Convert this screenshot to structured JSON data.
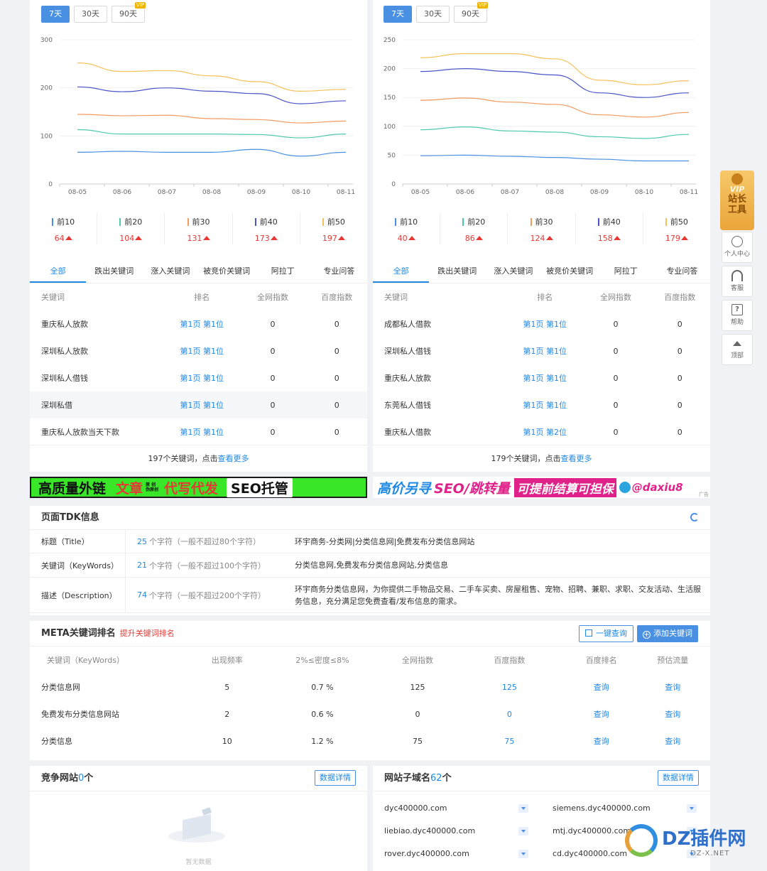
{
  "range_buttons": [
    "7天",
    "30天",
    "90天"
  ],
  "vip_tag": "VIP",
  "left": {
    "chart_data": {
      "type": "line",
      "categories": [
        "08-05",
        "08-06",
        "08-07",
        "08-08",
        "08-09",
        "08-10",
        "08-11"
      ],
      "ylim": [
        0,
        300
      ],
      "yticks": [
        0,
        100,
        200,
        300
      ],
      "series": [
        {
          "name": "前10",
          "color": "#4a90e2",
          "values": [
            66,
            68,
            66,
            66,
            72,
            58,
            66
          ]
        },
        {
          "name": "前20",
          "color": "#4ec9b0",
          "values": [
            113,
            104,
            104,
            104,
            103,
            96,
            104
          ]
        },
        {
          "name": "前30",
          "color": "#f29b5e",
          "values": [
            145,
            142,
            143,
            136,
            134,
            127,
            131
          ]
        },
        {
          "name": "前40",
          "color": "#4a56c8",
          "values": [
            202,
            192,
            200,
            193,
            188,
            167,
            173
          ]
        },
        {
          "name": "前50",
          "color": "#f5c15b",
          "values": [
            252,
            234,
            236,
            225,
            213,
            193,
            197
          ]
        }
      ]
    },
    "legend_values": [
      "64",
      "104",
      "131",
      "173",
      "197"
    ],
    "tabs": [
      "全部",
      "跌出关键词",
      "涨入关键词",
      "被竞价关键词",
      "阿拉丁",
      "专业问答"
    ],
    "columns": [
      "关键词",
      "排名",
      "全网指数",
      "百度指数"
    ],
    "rows": [
      [
        "重庆私人放款",
        "第1页 第1位",
        "0",
        "0"
      ],
      [
        "深圳私人放款",
        "第1页 第1位",
        "0",
        "0"
      ],
      [
        "深圳私人借钱",
        "第1页 第1位",
        "0",
        "0"
      ],
      [
        "深圳私借",
        "第1页 第1位",
        "0",
        "0"
      ],
      [
        "重庆私人放款当天下款",
        "第1页 第1位",
        "0",
        "0"
      ]
    ],
    "more_count": "197个关键词，点击",
    "more_link": "查看更多"
  },
  "right": {
    "chart_data": {
      "type": "line",
      "categories": [
        "08-05",
        "08-06",
        "08-07",
        "08-08",
        "08-09",
        "08-10",
        "08-11"
      ],
      "ylim": [
        0,
        250
      ],
      "yticks": [
        0,
        50,
        100,
        150,
        200,
        250
      ],
      "series": [
        {
          "name": "前10",
          "color": "#4a90e2",
          "values": [
            49,
            50,
            48,
            46,
            43,
            40,
            40
          ]
        },
        {
          "name": "前20",
          "color": "#4ec9b0",
          "values": [
            94,
            99,
            92,
            90,
            82,
            79,
            86
          ]
        },
        {
          "name": "前30",
          "color": "#f29b5e",
          "values": [
            145,
            149,
            142,
            138,
            120,
            116,
            124
          ]
        },
        {
          "name": "前40",
          "color": "#4a56c8",
          "values": [
            195,
            200,
            195,
            189,
            158,
            150,
            158
          ]
        },
        {
          "name": "前50",
          "color": "#f5c15b",
          "values": [
            219,
            226,
            226,
            217,
            180,
            172,
            179
          ]
        }
      ]
    },
    "legend_values": [
      "40",
      "86",
      "124",
      "158",
      "179"
    ],
    "tabs": [
      "全部",
      "跌出关键词",
      "涨入关键词",
      "被竞价关键词",
      "阿拉丁",
      "专业问答"
    ],
    "columns": [
      "关键词",
      "排名",
      "全网指数",
      "百度指数"
    ],
    "rows": [
      [
        "成都私人借款",
        "第1页 第1位",
        "0",
        "0"
      ],
      [
        "深圳私人借钱",
        "第1页 第1位",
        "0",
        "0"
      ],
      [
        "重庆私人放款",
        "第1页 第1位",
        "0",
        "0"
      ],
      [
        "东莞私人借钱",
        "第1页 第1位",
        "0",
        "0"
      ],
      [
        "重庆私人借款",
        "第1页 第2位",
        "0",
        "0"
      ]
    ],
    "more_count": "179个关键词，点击",
    "more_link": "查看更多"
  },
  "ads": {
    "left_text1": "高质量外链",
    "left_text2": "文章",
    "left_small": "原 创 伪原创",
    "left_text3": "代写代发",
    "left_text4": "SEO托管",
    "right_text1": "高价另寻",
    "right_text2": "SEO/跳转量",
    "right_text3": "可提前结算可担保",
    "right_text4": "@daxiu8",
    "ad_tag": "广告"
  },
  "tdk": {
    "title": "页面TDK信息",
    "rows": [
      {
        "label": "标题（Title）",
        "count": "25",
        "hint": "个字符（一般不超过80个字符）",
        "value": "环宇商务-分类网|分类信息网|免费发布分类信息网站"
      },
      {
        "label": "关键词（KeyWords）",
        "count": "21",
        "hint": "个字符（一般不超过100个字符）",
        "value": "分类信息网,免费发布分类信息网站,分类信息"
      },
      {
        "label": "描述（Description）",
        "count": "74",
        "hint": "个字符（一般不超过200个字符）",
        "value": "环宇商务分类信息网，为你提供二手物品交易、二手车买卖、房屋租售、宠物、招聘、兼职、求职、交友活动、生活服务信息，充分满足您免费查看/发布信息的需求。"
      }
    ]
  },
  "meta": {
    "title": "META关键词排名",
    "subtitle": "提升关键词排名",
    "query_btn": "一键查询",
    "add_btn": "添加关键词",
    "columns": [
      "关键词（KeyWords）",
      "出现频率",
      "2%≤密度≤8%",
      "全网指数",
      "百度指数",
      "百度排名",
      "预估流量"
    ],
    "rows": [
      [
        "分类信息网",
        "5",
        "0.7 %",
        "125",
        "125",
        "查询",
        "查询"
      ],
      [
        "免费发布分类信息网站",
        "2",
        "0.6 %",
        "0",
        "0",
        "查询",
        "查询"
      ],
      [
        "分类信息",
        "10",
        "1.2 %",
        "75",
        "75",
        "查询",
        "查询"
      ]
    ]
  },
  "competitors": {
    "title": "竞争网站",
    "count": "0",
    "unit": "个",
    "detail": "数据详情",
    "empty": "暂无数据"
  },
  "subdomains": {
    "title": "网站子域名",
    "count": "62",
    "unit": "个",
    "detail": "数据详情",
    "items": [
      "dyc400000.com",
      "siemens.dyc400000.com",
      "liebiao.dyc400000.com",
      "mtj.dyc400000.com",
      "rover.dyc400000.com",
      "cd.dyc400000.com"
    ]
  },
  "sidebar": {
    "vip_label": "VIP",
    "vip_text": "站长工具",
    "items": [
      "个人中心",
      "客服",
      "帮助",
      "顶部"
    ]
  },
  "watermark": {
    "text": "DZ插件网",
    "sub": "DZ-X.NET"
  }
}
